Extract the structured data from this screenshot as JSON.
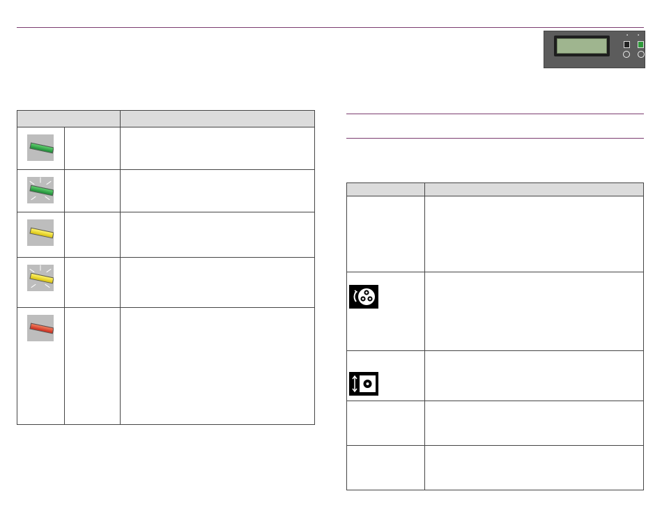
{
  "left_table": {
    "headers": [
      "",
      ""
    ],
    "rows": [
      {
        "icon": "led-green-solid-icon",
        "label": "",
        "description": ""
      },
      {
        "icon": "led-green-blinking-icon",
        "label": "",
        "description": ""
      },
      {
        "icon": "led-yellow-solid-icon",
        "label": "",
        "description": ""
      },
      {
        "icon": "led-yellow-blinking-icon",
        "label": "",
        "description": ""
      },
      {
        "icon": "led-red-solid-icon",
        "label": "",
        "description": ""
      }
    ],
    "colors": {
      "green": "#2fa34a",
      "yellow": "#f0e020",
      "red": "#e03a2a"
    }
  },
  "right_table": {
    "headers": [
      "",
      ""
    ],
    "rows": [
      {
        "icon": "",
        "label": "",
        "description": ""
      },
      {
        "icon": "tape-reels-rotate-icon",
        "label": "",
        "description": ""
      },
      {
        "icon": "cartridge-load-icon",
        "label": "",
        "description": ""
      },
      {
        "icon": "",
        "label": "",
        "description": ""
      },
      {
        "icon": "",
        "label": "",
        "description": ""
      }
    ]
  },
  "colors": {
    "rule": "#7a3b6e",
    "header_bg": "#dcdcdc"
  }
}
